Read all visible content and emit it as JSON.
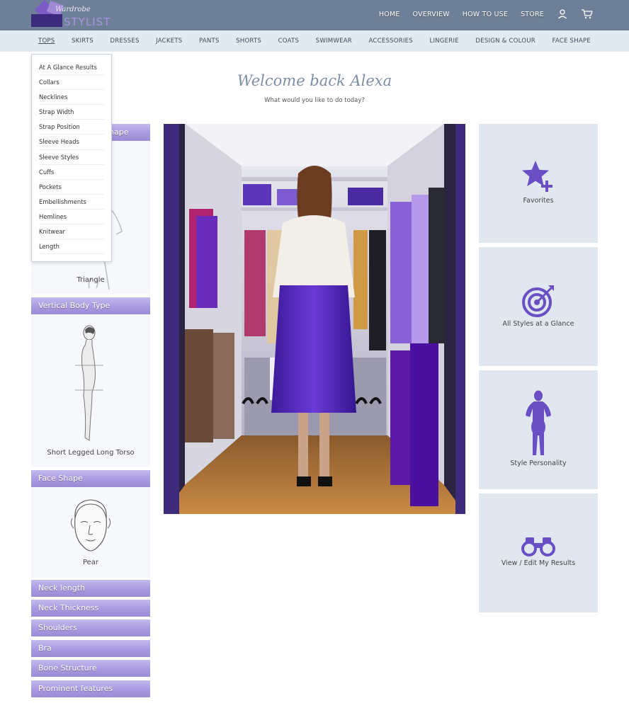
{
  "brand": {
    "script": "Wardrobe",
    "word": "STYLIST"
  },
  "topnav": {
    "items": [
      "HOME",
      "OVERVIEW",
      "HOW TO USE",
      "STORE"
    ],
    "user_icon": "user-icon",
    "cart_icon": "cart-icon"
  },
  "catbar": {
    "items": [
      "TOPS",
      "SKIRTS",
      "DRESSES",
      "JACKETS",
      "PANTS",
      "SHORTS",
      "COATS",
      "SWIMWEAR",
      "ACCESSORIES",
      "LINGERIE",
      "DESIGN & COLOUR",
      "FACE SHAPE"
    ],
    "active": "TOPS"
  },
  "dropdown": {
    "items": [
      "At A Glance Results",
      "Collars",
      "Necklines",
      "Strap Width",
      "Strap Position",
      "Sleeve Heads",
      "Sleeve Styles",
      "Cuffs",
      "Pockets",
      "Embellishments",
      "Hemlines",
      "Knitwear",
      "Length"
    ]
  },
  "welcome": {
    "title": "Welcome back Alexa",
    "subtitle": "What would you like to do today?"
  },
  "left": {
    "body_shape": {
      "heading_visible": "hape",
      "caption": "Triangle"
    },
    "vertical": {
      "heading": "Vertical Body Type",
      "caption": "Short Legged Long Torso"
    },
    "face": {
      "heading": "Face Shape",
      "caption": "Pear"
    },
    "collapsed": [
      "Neck length",
      "Neck Thickness",
      "Shoulders",
      "Bra",
      "Bone Structure",
      "Prominent features"
    ]
  },
  "cards": [
    {
      "label": "Favorites",
      "icon": "star-plus-icon"
    },
    {
      "label": "All Styles at a Glance",
      "icon": "target-icon"
    },
    {
      "label": "Style Personality",
      "icon": "woman-silhouette-icon"
    },
    {
      "label": "View / Edit My Results",
      "icon": "binoculars-icon"
    }
  ],
  "colors": {
    "header": "#6e8097",
    "catbar": "#e2eaf1",
    "accent_purple": "#6a4fc4",
    "section_head": "#a99ae0",
    "card_bg": "#e0e7ef"
  }
}
